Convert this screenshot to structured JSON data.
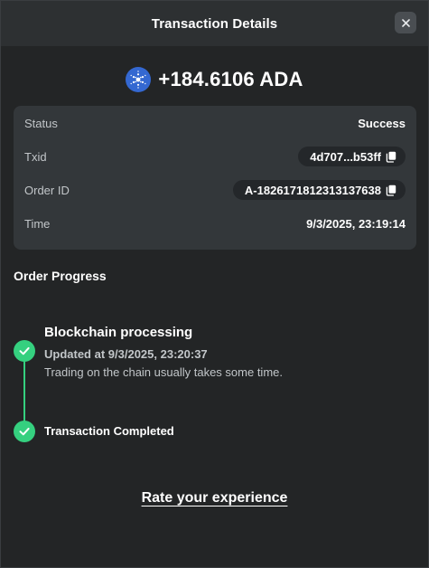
{
  "header": {
    "title": "Transaction Details",
    "close_icon": "close-icon"
  },
  "amount": {
    "coin_icon": "cardano-logo-icon",
    "text": "+184.6106 ADA",
    "coin_color": "#3468d1"
  },
  "details": {
    "status": {
      "label": "Status",
      "value": "Success"
    },
    "txid": {
      "label": "Txid",
      "value": "4d707...b53ff",
      "icon": "copy-icon"
    },
    "order_id": {
      "label": "Order ID",
      "value": "A-1826171812313137638",
      "icon": "copy-icon"
    },
    "time": {
      "label": "Time",
      "value": "9/3/2025, 23:19:14"
    }
  },
  "progress": {
    "title": "Order Progress",
    "accent_color": "#35d07f",
    "steps": [
      {
        "title": "Blockchain processing",
        "updated": "Updated at 9/3/2025, 23:20:37",
        "description": "Trading on the chain usually takes some time.",
        "icon": "check-icon"
      },
      {
        "title": "Transaction Completed",
        "icon": "check-icon"
      }
    ]
  },
  "footer": {
    "rate_label": "Rate your experience"
  }
}
